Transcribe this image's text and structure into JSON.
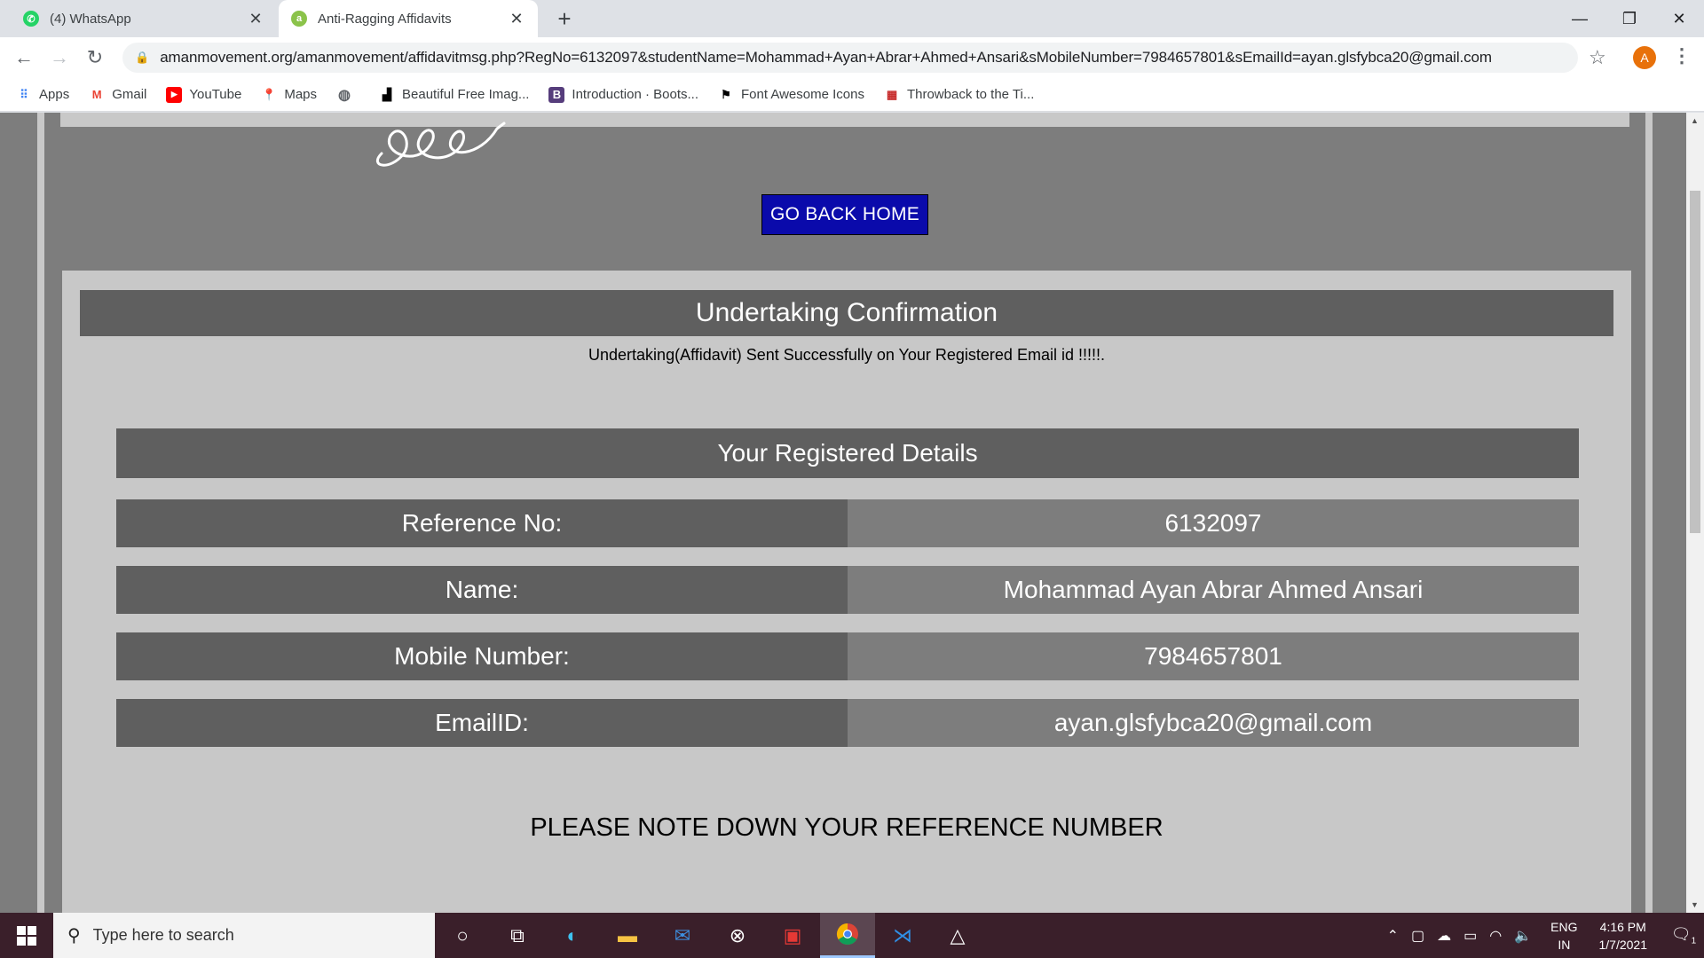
{
  "browser": {
    "tabs": [
      {
        "label": "(4) WhatsApp",
        "favicon": "whatsapp-icon",
        "active": false
      },
      {
        "label": "Anti-Ragging Affidavits",
        "favicon": "site-icon",
        "active": true
      }
    ],
    "url": "amanmovement.org/amanmovement/affidavitmsg.php?RegNo=6132097&studentName=Mohammad+Ayan+Abrar+Ahmed+Ansari&sMobileNumber=7984657801&sEmailId=ayan.glsfybca20@gmail.com",
    "profile_initial": "A",
    "bookmarks": [
      {
        "label": "Apps",
        "icon": "apps-grid-icon"
      },
      {
        "label": "Gmail",
        "icon": "gmail-icon"
      },
      {
        "label": "YouTube",
        "icon": "youtube-icon"
      },
      {
        "label": "Maps",
        "icon": "maps-icon"
      },
      {
        "label": "",
        "icon": "globe-icon"
      },
      {
        "label": "Beautiful Free Imag...",
        "icon": "unsplash-icon"
      },
      {
        "label": "Introduction · Boots...",
        "icon": "bootstrap-icon"
      },
      {
        "label": "Font Awesome Icons",
        "icon": "fontawesome-icon"
      },
      {
        "label": "Throwback to the Ti...",
        "icon": "throwback-icon"
      }
    ]
  },
  "page": {
    "go_home_label": "GO BACK HOME",
    "card_title": "Undertaking Confirmation",
    "success_message": "Undertaking(Affidavit) Sent Successfully on Your Registered Email id !!!!!.",
    "details_title": "Your Registered Details",
    "details": [
      {
        "label": "Reference No:",
        "value": "6132097"
      },
      {
        "label": "Name:",
        "value": "Mohammad Ayan Abrar Ahmed Ansari"
      },
      {
        "label": "Mobile Number:",
        "value": "7984657801"
      },
      {
        "label": "EmailID:",
        "value": "ayan.glsfybca20@gmail.com"
      }
    ],
    "note": "PLEASE NOTE DOWN YOUR REFERENCE NUMBER"
  },
  "taskbar": {
    "search_placeholder": "Type here to search",
    "language": "ENG",
    "region": "IN",
    "time": "4:16 PM",
    "date": "1/7/2021",
    "notification_count": "1"
  },
  "colors": {
    "go_home_button": "#0a0aab",
    "header_band": "#5f5f5f",
    "card_background": "#c8c8c8",
    "page_background": "#7d7d7d"
  }
}
